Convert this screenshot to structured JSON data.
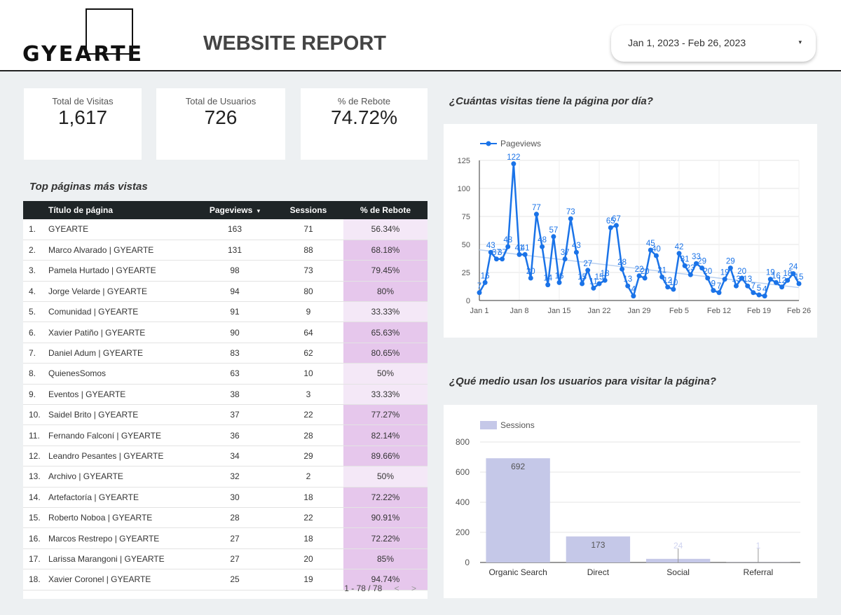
{
  "header": {
    "logo_text": "GYEARTE",
    "title": "WEBSITE REPORT",
    "date_range": "Jan 1, 2023 - Feb 26, 2023",
    "caret": "▾"
  },
  "kpis": [
    {
      "label": "Total de Visitas",
      "value": "1,617"
    },
    {
      "label": "Total de Usuarios",
      "value": "726"
    },
    {
      "label": "% de Rebote",
      "value": "74.72%"
    }
  ],
  "table": {
    "section_title": "Top páginas más vistas",
    "columns": [
      "Título de página",
      "Pageviews",
      "Sessions",
      "% de Rebote"
    ],
    "sort_indicator": "▾",
    "rows": [
      {
        "idx": "1.",
        "page": "GYEARTE",
        "pv": "163",
        "ss": "71",
        "rb": "56.34%",
        "rbv": 56.34
      },
      {
        "idx": "2.",
        "page": "Marco Alvarado | GYEARTE",
        "pv": "131",
        "ss": "88",
        "rb": "68.18%",
        "rbv": 68.18
      },
      {
        "idx": "3.",
        "page": "Pamela Hurtado | GYEARTE",
        "pv": "98",
        "ss": "73",
        "rb": "79.45%",
        "rbv": 79.45
      },
      {
        "idx": "4.",
        "page": "Jorge Velarde | GYEARTE",
        "pv": "94",
        "ss": "80",
        "rb": "80%",
        "rbv": 80
      },
      {
        "idx": "5.",
        "page": "Comunidad | GYEARTE",
        "pv": "91",
        "ss": "9",
        "rb": "33.33%",
        "rbv": 33.33
      },
      {
        "idx": "6.",
        "page": "Xavier Patiño | GYEARTE",
        "pv": "90",
        "ss": "64",
        "rb": "65.63%",
        "rbv": 65.63
      },
      {
        "idx": "7.",
        "page": "Daniel Adum | GYEARTE",
        "pv": "83",
        "ss": "62",
        "rb": "80.65%",
        "rbv": 80.65
      },
      {
        "idx": "8.",
        "page": "QuienesSomos",
        "pv": "63",
        "ss": "10",
        "rb": "50%",
        "rbv": 50
      },
      {
        "idx": "9.",
        "page": "Eventos | GYEARTE",
        "pv": "38",
        "ss": "3",
        "rb": "33.33%",
        "rbv": 33.33
      },
      {
        "idx": "10.",
        "page": "Saidel Brito | GYEARTE",
        "pv": "37",
        "ss": "22",
        "rb": "77.27%",
        "rbv": 77.27
      },
      {
        "idx": "11.",
        "page": "Fernando Falconí | GYEARTE",
        "pv": "36",
        "ss": "28",
        "rb": "82.14%",
        "rbv": 82.14
      },
      {
        "idx": "12.",
        "page": "Leandro Pesantes | GYEARTE",
        "pv": "34",
        "ss": "29",
        "rb": "89.66%",
        "rbv": 89.66
      },
      {
        "idx": "13.",
        "page": "Archivo | GYEARTE",
        "pv": "32",
        "ss": "2",
        "rb": "50%",
        "rbv": 50
      },
      {
        "idx": "14.",
        "page": "Artefactoría | GYEARTE",
        "pv": "30",
        "ss": "18",
        "rb": "72.22%",
        "rbv": 72.22
      },
      {
        "idx": "15.",
        "page": "Roberto Noboa | GYEARTE",
        "pv": "28",
        "ss": "22",
        "rb": "90.91%",
        "rbv": 90.91
      },
      {
        "idx": "16.",
        "page": "Marcos Restrepo | GYEARTE",
        "pv": "27",
        "ss": "18",
        "rb": "72.22%",
        "rbv": 72.22
      },
      {
        "idx": "17.",
        "page": "Larissa Marangoni | GYEARTE",
        "pv": "27",
        "ss": "20",
        "rb": "85%",
        "rbv": 85
      },
      {
        "idx": "18.",
        "page": "Xavier Coronel | GYEARTE",
        "pv": "25",
        "ss": "19",
        "rb": "94.74%",
        "rbv": 94.74
      }
    ],
    "pager": "1 - 78 / 78",
    "prev": "<",
    "next": ">"
  },
  "colors": {
    "line": "#1a73e8",
    "bar": "#c5c8e8",
    "rebote_high": "#e6c7ec",
    "rebote_low": "#f4e8f7",
    "table_header": "#1f2527"
  },
  "line_chart": {
    "section_title": "¿Cuántas visitas tiene la página por día?",
    "chart_data": {
      "type": "line",
      "legend": "Pageviews",
      "legend_position": "top-left",
      "y_ticks": [
        0,
        25,
        50,
        75,
        100,
        125
      ],
      "x_ticks": [
        "Jan 1",
        "Jan 8",
        "Jan 15",
        "Jan 22",
        "Jan 29",
        "Feb 5",
        "Feb 12",
        "Feb 19",
        "Feb 26"
      ],
      "ylim": [
        0,
        125
      ],
      "series": [
        {
          "name": "Pageviews",
          "values": [
            7,
            16,
            43,
            37,
            37,
            48,
            122,
            41,
            41,
            20,
            77,
            48,
            14,
            57,
            16,
            37,
            73,
            43,
            15,
            27,
            11,
            15,
            18,
            65,
            67,
            28,
            13,
            4,
            22,
            20,
            45,
            40,
            21,
            12,
            10,
            42,
            31,
            23,
            33,
            29,
            20,
            9,
            7,
            19,
            29,
            13,
            20,
            13,
            7,
            5,
            4,
            19,
            16,
            12,
            18,
            24,
            15
          ]
        }
      ]
    }
  },
  "bar_chart": {
    "section_title": "¿Qué medio usan los usuarios para visitar la página?",
    "chart_data": {
      "type": "bar",
      "legend": "Sessions",
      "legend_position": "top-left",
      "categories": [
        "Organic Search",
        "Direct",
        "Social",
        "Referral"
      ],
      "values": [
        692,
        173,
        24,
        1
      ],
      "y_ticks": [
        0,
        200,
        400,
        600,
        800
      ],
      "ylim": [
        0,
        800
      ]
    }
  }
}
